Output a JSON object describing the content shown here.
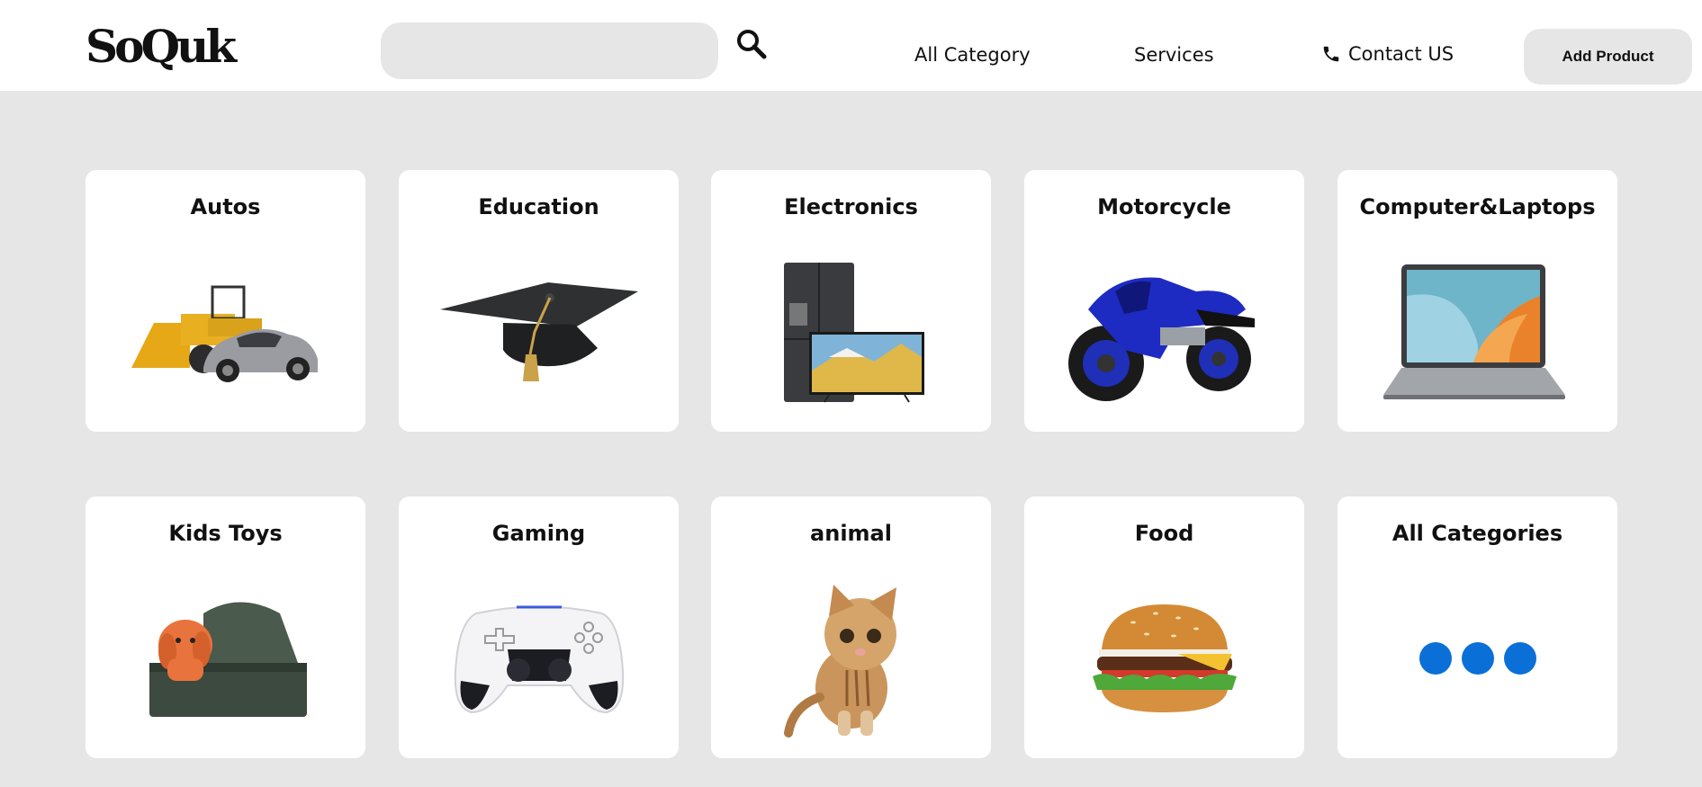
{
  "header": {
    "logo": "SoQuk",
    "search": {
      "value": "",
      "placeholder": ""
    },
    "nav": {
      "all_category": "All Category",
      "services": "Services",
      "contact": "Contact US"
    },
    "add_product": "Add Product"
  },
  "categories": [
    {
      "label": "Autos",
      "image": "construction-loader-and-sports-car"
    },
    {
      "label": "Education",
      "image": "graduation-cap"
    },
    {
      "label": "Electronics",
      "image": "refrigerator-and-tv"
    },
    {
      "label": "Motorcycle",
      "image": "blue-sport-motorcycle"
    },
    {
      "label": "Computer&Laptops",
      "image": "laptop"
    },
    {
      "label": "Kids Toys",
      "image": "plush-dog-and-stroller"
    },
    {
      "label": "Gaming",
      "image": "game-controller"
    },
    {
      "label": "animal",
      "image": "kitten"
    },
    {
      "label": "Food",
      "image": "burger"
    },
    {
      "label": "All Categories",
      "image": "three-dots"
    }
  ],
  "colors": {
    "background": "#e6e6e6",
    "card": "#ffffff",
    "dots": "#0b6fd8",
    "text": "#111111"
  }
}
